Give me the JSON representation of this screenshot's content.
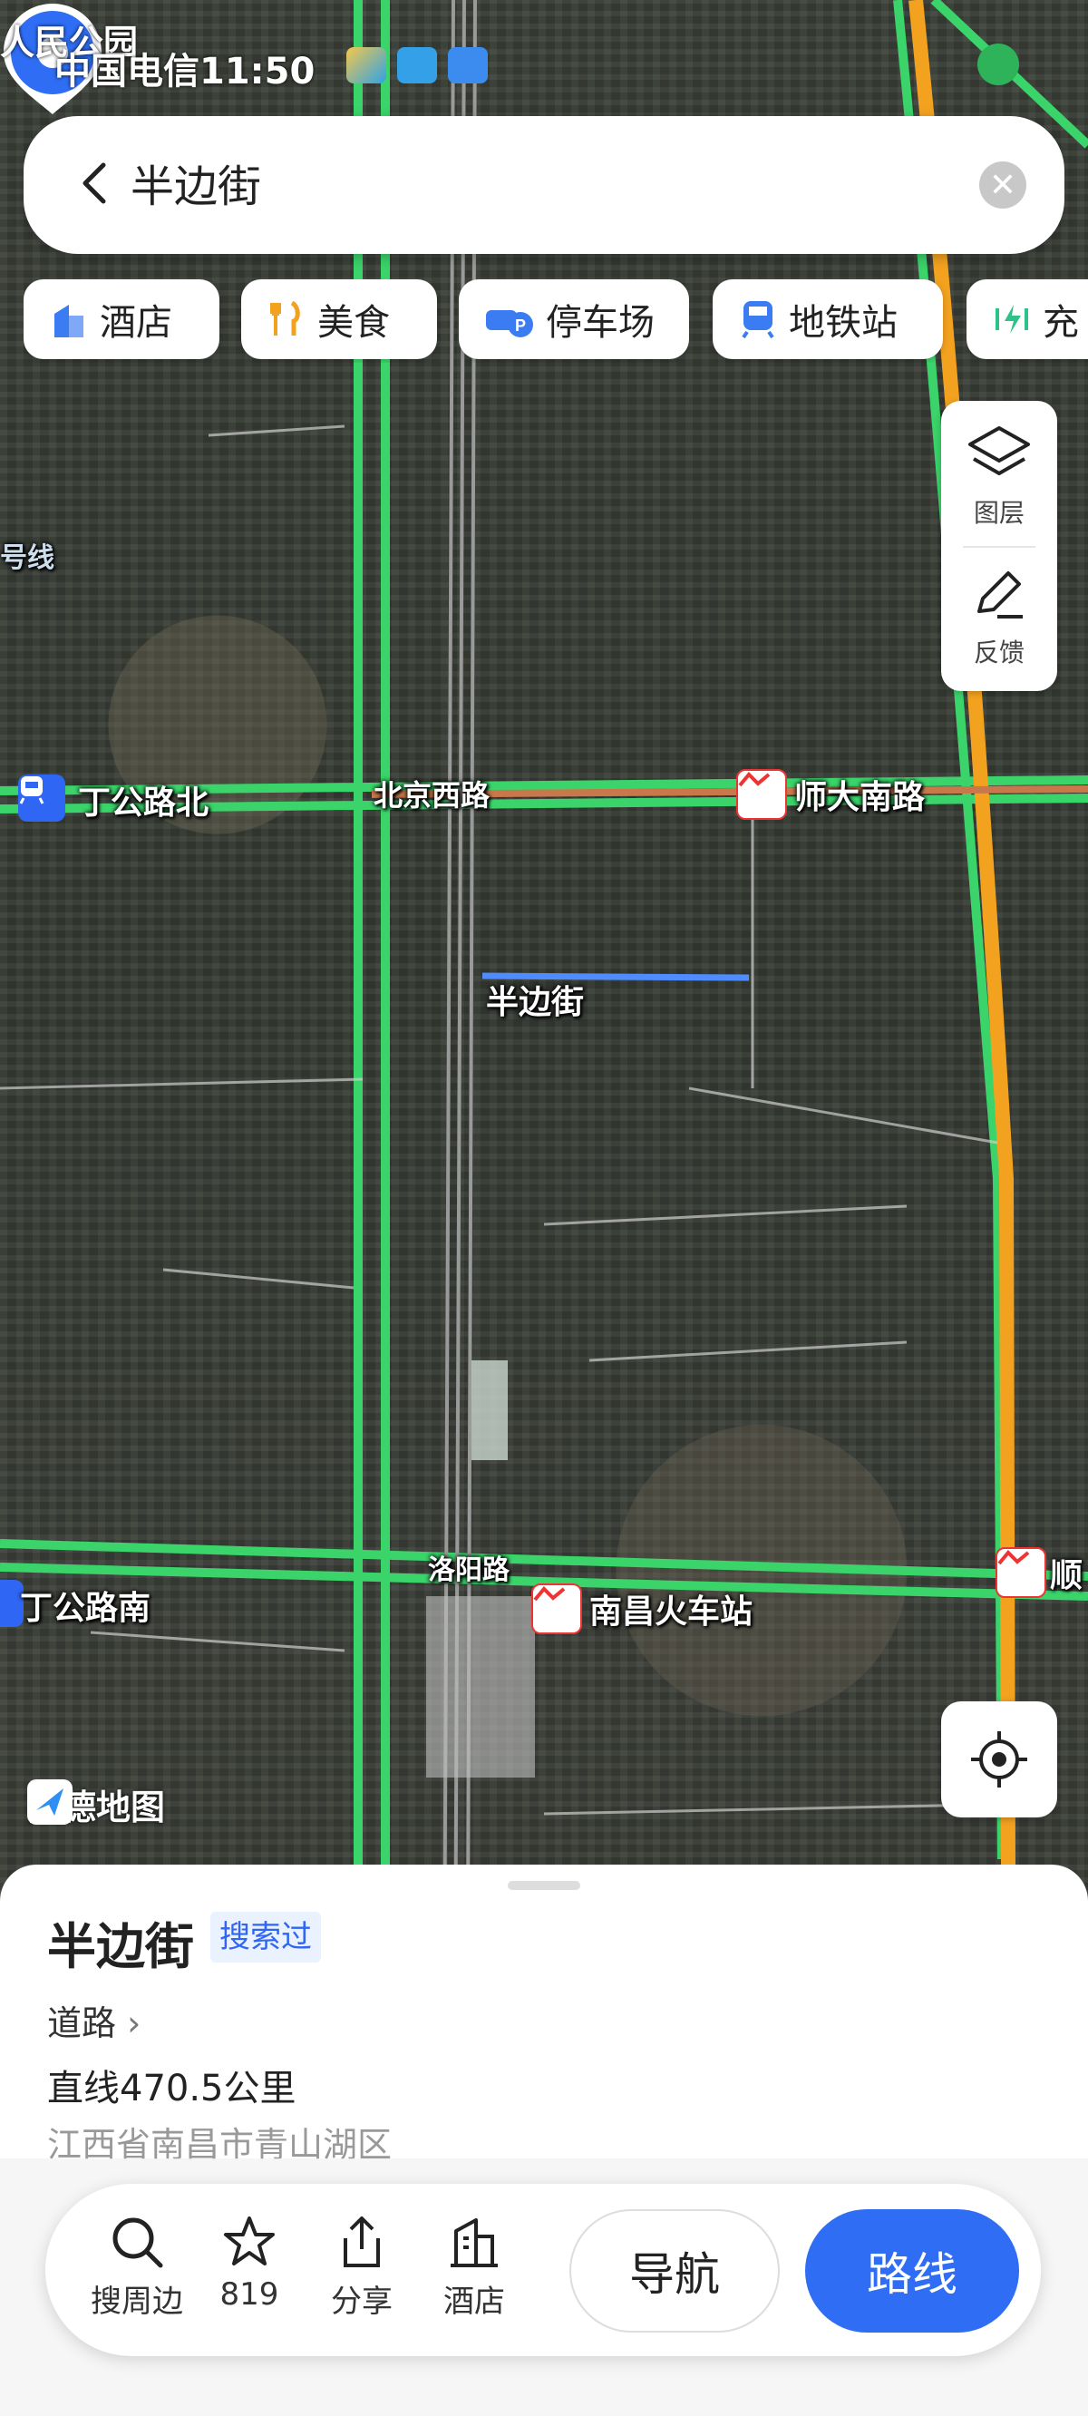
{
  "status_bar": {
    "carrier_time": "中国电信11:50",
    "park_label": "人民公园"
  },
  "search": {
    "query": "半边街"
  },
  "chips": [
    {
      "label": "酒店",
      "icon": "hotel-icon"
    },
    {
      "label": "美食",
      "icon": "food-icon"
    },
    {
      "label": "停车场",
      "icon": "parking-icon"
    },
    {
      "label": "地铁站",
      "icon": "metro-icon"
    },
    {
      "label": "充",
      "icon": "charging-icon"
    }
  ],
  "tools": {
    "layers": "图层",
    "feedback": "反馈"
  },
  "map": {
    "labels": {
      "line_tag": "号线",
      "dinggong_north": "丁公路北",
      "beijing_west": "北京西路",
      "shida_south": "师大南路",
      "pin_name": "半边街",
      "luoyang": "洛阳路",
      "dinggong_south": "丁公路南",
      "nanchang_station": "南昌火车站",
      "shun": "顺"
    },
    "logo": "高德地图",
    "colors": {
      "road_green": "#3ad46a",
      "road_orange": "#f3a21f",
      "pin_blue": "#2f6ef4",
      "metro_blue": "#2f66f3"
    }
  },
  "poi": {
    "name": "半边街",
    "badge": "搜索过",
    "category": "道路",
    "distance": "直线470.5公里",
    "address": "江西省南昌市青山湖区"
  },
  "actions": [
    {
      "label": "搜周边",
      "icon": "search-icon"
    },
    {
      "label": "819",
      "icon": "star-icon"
    },
    {
      "label": "分享",
      "icon": "share-icon"
    },
    {
      "label": "酒店",
      "icon": "hotel-icon"
    }
  ],
  "buttons": {
    "navigate": "导航",
    "route": "路线"
  }
}
